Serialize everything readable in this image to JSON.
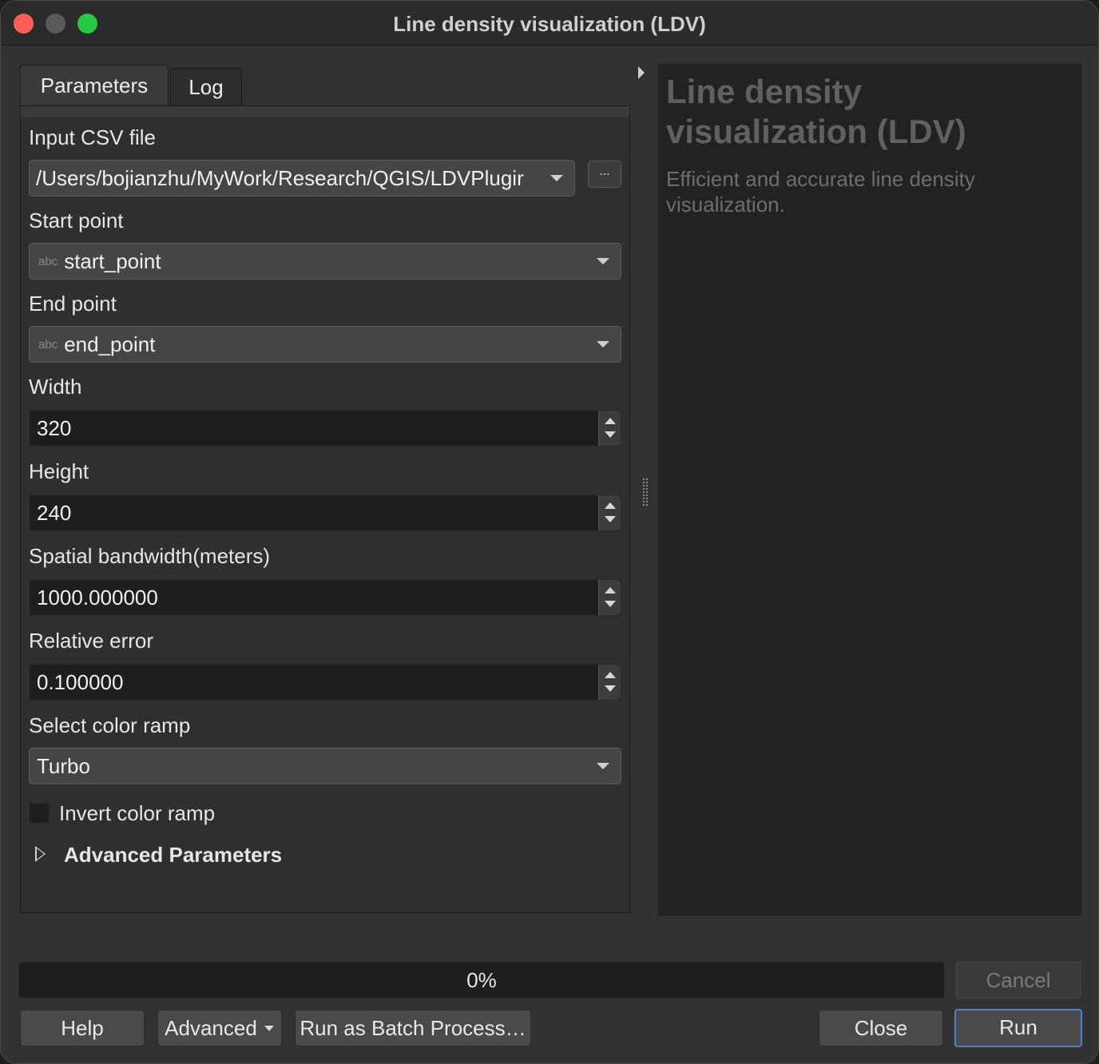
{
  "window": {
    "title": "Line density visualization (LDV)"
  },
  "tabs": [
    {
      "label": "Parameters",
      "active": true
    },
    {
      "label": "Log",
      "active": false
    }
  ],
  "params": {
    "input_csv": {
      "label": "Input CSV file",
      "value": "/Users/bojianzhu/MyWork/Research/QGIS/LDVPlugir",
      "browse_label": "..."
    },
    "start_point": {
      "label": "Start point",
      "type_icon": "abc",
      "value": "start_point"
    },
    "end_point": {
      "label": "End point",
      "type_icon": "abc",
      "value": "end_point"
    },
    "width": {
      "label": "Width",
      "value": "320"
    },
    "height": {
      "label": "Height",
      "value": "240"
    },
    "bandwidth": {
      "label": "Spatial bandwidth(meters)",
      "value": "1000.000000"
    },
    "relative_error": {
      "label": "Relative error",
      "value": "0.100000"
    },
    "color_ramp": {
      "label": "Select color ramp",
      "value": "Turbo"
    },
    "invert": {
      "label": "Invert color ramp",
      "checked": false
    },
    "advanced": {
      "label": "Advanced Parameters"
    }
  },
  "help": {
    "title": "Line density visualization (LDV)",
    "description": "Efficient and accurate line density visualization."
  },
  "progress": {
    "value": 0,
    "label": "0%"
  },
  "buttons": {
    "cancel": "Cancel",
    "help": "Help",
    "advanced": "Advanced",
    "batch": "Run as Batch Process…",
    "close": "Close",
    "run": "Run"
  },
  "colors": {
    "window_bg": "#323232",
    "panel_bg": "#2f2f2f",
    "input_bg": "#1e1e1e",
    "accent": "#4e7fd0"
  }
}
